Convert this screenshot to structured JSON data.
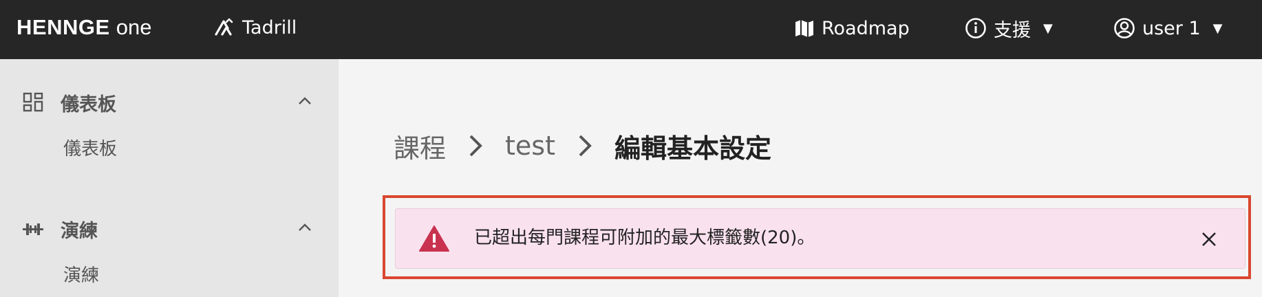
{
  "header": {
    "brand": "HENNGE",
    "brand_suffix": "one",
    "product": "Tadrill",
    "roadmap_label": "Roadmap",
    "support_label": "支援",
    "user_label": "user 1"
  },
  "sidebar": {
    "sections": [
      {
        "label": "儀表板",
        "items": [
          {
            "label": "儀表板"
          }
        ]
      },
      {
        "label": "演練",
        "items": [
          {
            "label": "演練"
          }
        ]
      }
    ]
  },
  "breadcrumb": {
    "items": [
      "課程",
      "test"
    ],
    "current": "編輯基本設定"
  },
  "alert": {
    "type": "error",
    "message": "已超出每門課程可附加的最大標籤數(20)。"
  },
  "colors": {
    "topbar": "#262626",
    "alert_bg": "#fae1ee",
    "alert_icon": "#c8324f",
    "highlight_border": "#d9472f"
  }
}
